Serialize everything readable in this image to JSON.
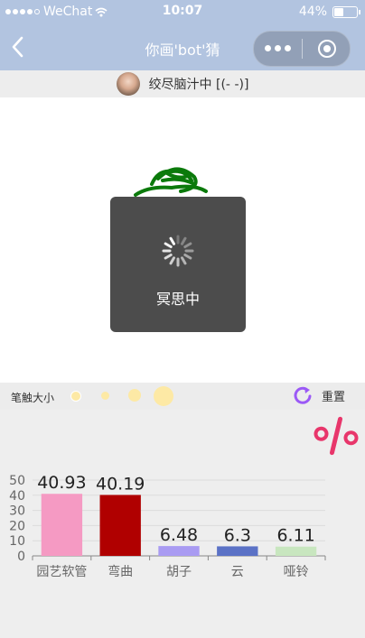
{
  "status_bar": {
    "carrier": "WeChat",
    "time": "10:07",
    "battery_text": "44%",
    "battery_level": 0.44
  },
  "nav": {
    "title": "你画'bot'猜"
  },
  "thinking": {
    "text": "绞尽脑汁中 [(- -)]"
  },
  "loading": {
    "text": "冥思中"
  },
  "brush": {
    "label": "笔触大小",
    "reset_label": "重置"
  },
  "colors": {
    "brand": "#b2c4e0",
    "toast": "#4c4c4c",
    "drawing": "#0b7a0b",
    "reset_icon": "#9b59f6",
    "percent_icon": "#e8366b"
  },
  "chart_data": {
    "type": "bar",
    "categories": [
      "园艺软管",
      "弯曲",
      "胡子",
      "云",
      "哑铃"
    ],
    "values": [
      40.93,
      40.19,
      6.48,
      6.3,
      6.11
    ],
    "colors": [
      "#f59ac3",
      "#b00000",
      "#a99bf2",
      "#5b72c6",
      "#c8e6bf"
    ],
    "ylim": [
      0,
      50
    ],
    "yticks": [
      0,
      10,
      20,
      30,
      40,
      50
    ],
    "grid": true
  }
}
